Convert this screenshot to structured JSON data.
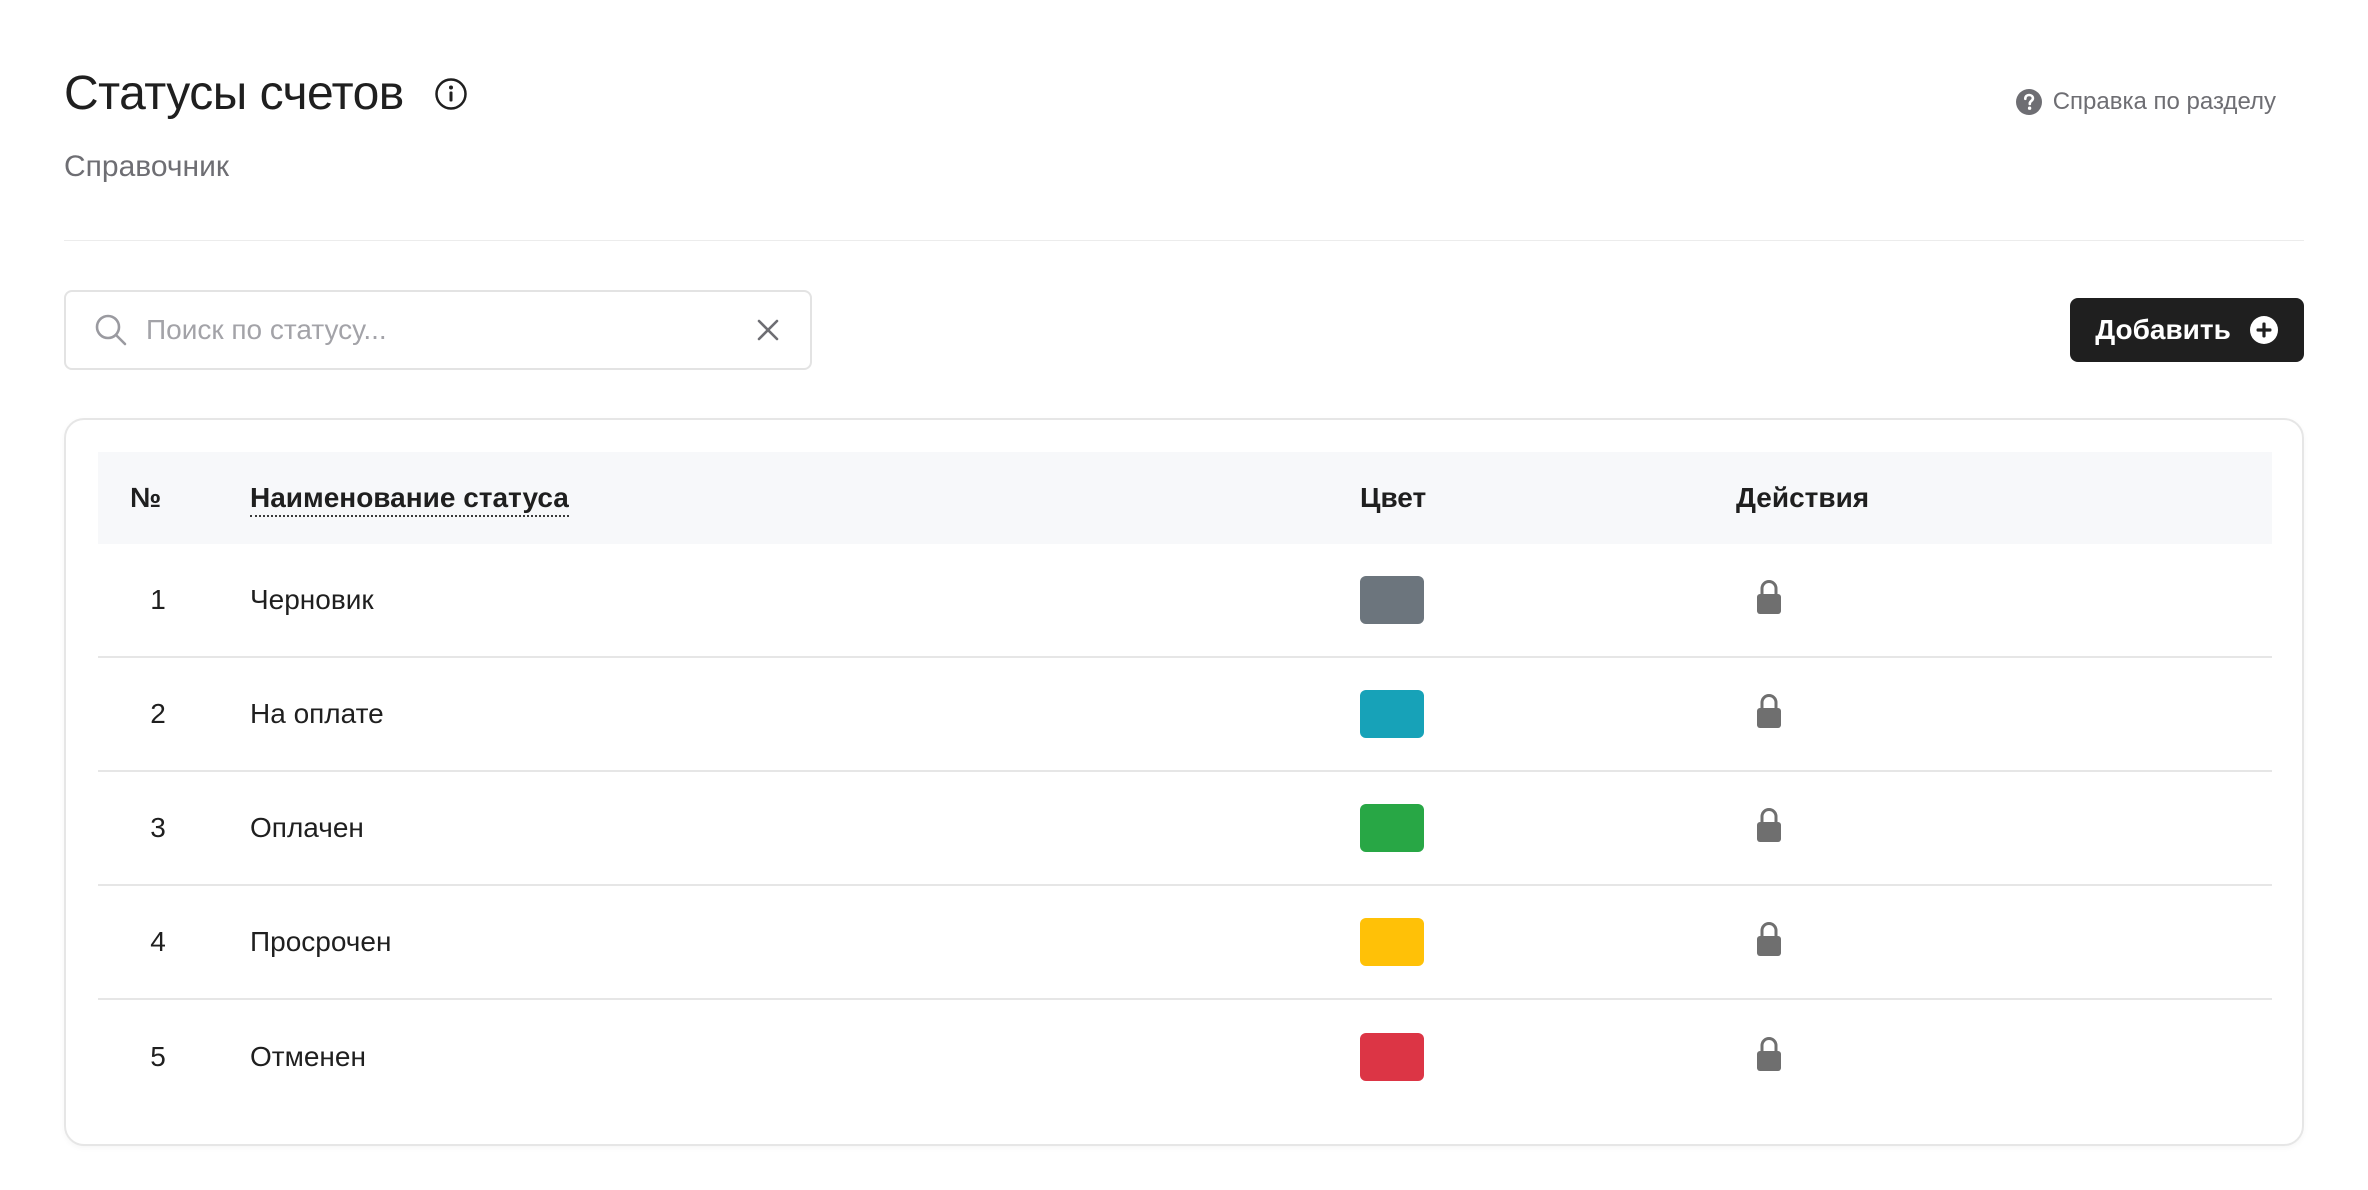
{
  "header": {
    "title": "Статусы счетов",
    "subtitle": "Справочник",
    "help_label": "Справка по разделу"
  },
  "search": {
    "placeholder": "Поиск по статусу...",
    "value": ""
  },
  "toolbar": {
    "add_label": "Добавить"
  },
  "table": {
    "columns": {
      "num": "№",
      "name": "Наименование статуса",
      "color": "Цвет",
      "actions": "Действия"
    },
    "rows": [
      {
        "num": "1",
        "name": "Черновик",
        "color": "#6c757d"
      },
      {
        "num": "2",
        "name": "На оплате",
        "color": "#17a2b8"
      },
      {
        "num": "3",
        "name": "Оплачен",
        "color": "#28a745"
      },
      {
        "num": "4",
        "name": "Просрочен",
        "color": "#ffc107"
      },
      {
        "num": "5",
        "name": "Отменен",
        "color": "#dc3545"
      }
    ]
  },
  "icons": {
    "info": "info-icon",
    "help": "question-circle-icon",
    "search": "search-icon",
    "clear": "close-icon",
    "add": "plus-circle-icon",
    "row_action": "lock-icon"
  },
  "colors": {
    "primary_button": "#1f1f1f",
    "muted_text": "#6e6e73",
    "lock": "#6f6f6f"
  }
}
